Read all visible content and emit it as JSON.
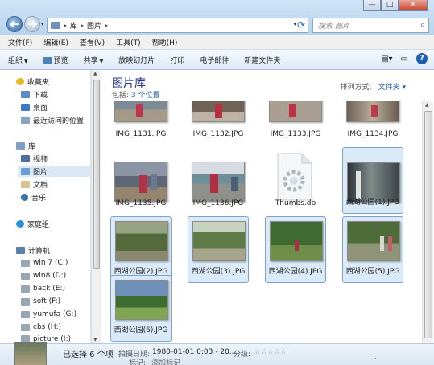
{
  "title_bar": {
    "minimize": "—",
    "maximize": "□",
    "close": "✕"
  },
  "address_bar": {
    "crumbs": [
      "库",
      "图片"
    ],
    "separator": "▸"
  },
  "search": {
    "placeholder": "搜索 图片"
  },
  "menu": [
    "文件(F)",
    "编辑(E)",
    "查看(V)",
    "工具(T)",
    "帮助(H)"
  ],
  "toolbar": {
    "organize": "组织",
    "preview": "预览",
    "share": "共享",
    "slideshow": "放映幻灯片",
    "print": "打印",
    "email": "电子邮件",
    "new_folder": "新建文件夹"
  },
  "sidebar": {
    "favorites": {
      "label": "收藏夹",
      "items": [
        "下载",
        "桌面",
        "最近访问的位置"
      ]
    },
    "libraries": {
      "label": "库",
      "items": [
        "视频",
        "图片",
        "文档",
        "音乐"
      ]
    },
    "homegroup": "家庭组",
    "computer": {
      "label": "计算机",
      "items": [
        "win 7 (C:)",
        "win8 (D:)",
        "back (E:)",
        "soft (F:)",
        "yumufa (G:)",
        "cbs (H:)",
        "picture (I:)"
      ]
    }
  },
  "library": {
    "title": "图片库",
    "includes_label": "包括:",
    "includes_link": "3 个位置",
    "arrange_label": "排列方式:",
    "arrange_value": "文件夹"
  },
  "files": [
    {
      "name": "IMG_1131.JPG",
      "selected": false
    },
    {
      "name": "IMG_1132.JPG",
      "selected": false
    },
    {
      "name": "IMG_1133.JPG",
      "selected": false
    },
    {
      "name": "IMG_1134.JPG",
      "selected": false
    },
    {
      "name": "IMG_1135.JPG",
      "selected": false
    },
    {
      "name": "IMG_1136.JPG",
      "selected": false
    },
    {
      "name": "Thumbs.db",
      "selected": false
    },
    {
      "name": "西湖公园(1).JPG",
      "selected": true
    },
    {
      "name": "西湖公园(2).JPG",
      "selected": true
    },
    {
      "name": "西湖公园(3).JPG",
      "selected": true
    },
    {
      "name": "西湖公园(4).JPG",
      "selected": true
    },
    {
      "name": "西湖公园(5).JPG",
      "selected": true
    },
    {
      "name": "西湖公园(6).JPG",
      "selected": true
    }
  ],
  "details": {
    "selection": "已选择 6 个项",
    "date_label": "拍摄日期:",
    "date_value": "1980-01-01 0:03 - 20...",
    "rating_label": "分级:",
    "stars": "☆☆☆☆☆",
    "tags_label": "标记:",
    "tags_value": "添加标记"
  },
  "colors": {
    "selection_bg": "#dbeaf9",
    "selection_border": "#7da2ce",
    "link": "#1e5aa8",
    "library_title": "#1e3287"
  }
}
